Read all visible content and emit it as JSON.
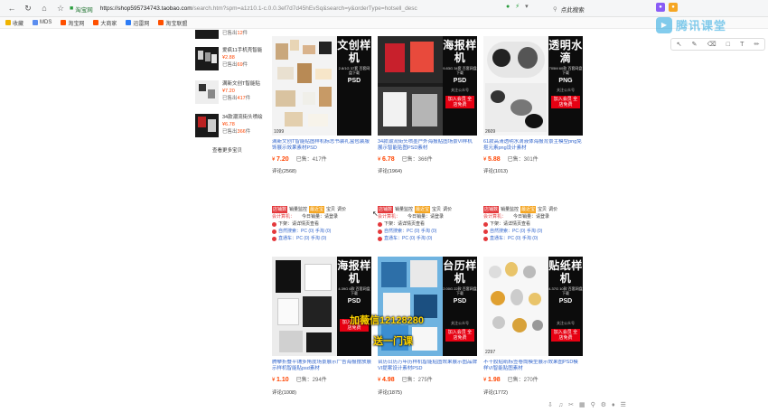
{
  "browser": {
    "site_badge": "淘宝网",
    "url_host": "https://shop595734743.taobao.com",
    "url_path": "/search.htm?spm=a1z10.1-c.0.0.3ef7d7d45hEvSq&search=y&orderType=hotsell_desc",
    "search_placeholder": "点此搜索"
  },
  "bookmarks": [
    {
      "label": "收藏",
      "color": "#f0b400"
    },
    {
      "label": "MDS",
      "color": "#5b8def"
    },
    {
      "label": "淘宝网",
      "color": "#ff5000"
    },
    {
      "label": "大商家",
      "color": "#ff5000"
    },
    {
      "label": "迅雷网",
      "color": "#2e7df6"
    },
    {
      "label": "淘宝联盟",
      "color": "#ff5000"
    }
  ],
  "overlay": {
    "class_logo": "腾讯课堂",
    "watermark_line1": "加薇信12128280",
    "watermark_line2": "送一门课"
  },
  "sidebar": {
    "top_sold_prefix": "已售出",
    "top_sold_count": "12",
    "top_sold_suffix": "件",
    "items": [
      {
        "title": "爱疯11手机壳智能",
        "price": "¥2.88",
        "sold_prefix": "已售出",
        "sold_count": "69",
        "sold_suffix": "件"
      },
      {
        "title": "满新文创T智能贴",
        "price": "¥7.20",
        "sold_prefix": "已售出",
        "sold_count": "417",
        "sold_suffix": "件"
      },
      {
        "title": "34款潮流街头喷绘",
        "price": "¥6.78",
        "sold_prefix": "已售出",
        "sold_count": "366",
        "sold_suffix": "件"
      }
    ],
    "more_link": "查看更多宝贝"
  },
  "products_row1": [
    {
      "big_title": "文创样机",
      "spec": "2.8/1G 37套 百套网盘下载",
      "format": "PSD",
      "img_count": "1099",
      "title": "满新文创T智能贴图样机标志书装礼盒包装服饰展示效果素材PSD",
      "price": "7.20",
      "sold": "已售：417件",
      "review": "评论(2568)"
    },
    {
      "big_title": "海报样机",
      "spec": "9.83G 34套 百套网盘下载",
      "format": "PSD",
      "qr": "关注公众号",
      "vip": "加入会员 全店免费",
      "img_count": "",
      "title": "34款潮流街头喷墨户外海报贴图场景VI样机展示智能贴图PSD素材",
      "price": "6.78",
      "sold": "已售：366件",
      "review": "评论(1964)"
    },
    {
      "big_title": "透明水滴",
      "spec": "705M 60款 百套网盘下载",
      "format": "PNG",
      "qr": "关注公众号",
      "vip": "加入会员 全店免费",
      "img_count": "2609",
      "title": "61款高清透明水滴液体海报背景主模型png免抠元素png设计素材",
      "price": "5.88",
      "sold": "已售：301件",
      "review": "评论(1013)"
    }
  ],
  "products_row2": [
    {
      "tag1": "店铺数",
      "tag2": "销量监控",
      "tag3": "最近宝",
      "tag4": "宝贝",
      "tag5": "调价",
      "line2": "会计算机：",
      "line2b": "今日销量：请登录",
      "line3": "下架：请详情页查看",
      "line4": "自然搜索：PC (0) 手淘 (0)",
      "line5": "直通车：PC (0) 手淘 (0)",
      "big_title": "海报样机",
      "spec": "4.39G 6款 百套网盘下载",
      "format": "PSD",
      "vip": "加入会员 全店免费",
      "title": "腾攀折叠平铺多角度场景展示广告海报摆放展示样机智能贴psd素材",
      "price": "1.10",
      "sold": "已售：294件",
      "review": "评论(1008)"
    },
    {
      "tag1": "店铺数",
      "tag2": "销量监控",
      "tag3": "最近宝",
      "tag4": "宝贝",
      "tag5": "调价",
      "line2": "会计算机：",
      "line2b": "今日销量：请登录",
      "line3": "下架：请详情页查看",
      "line4": "自然搜索：PC (0) 手淘 (0)",
      "line5": "直通车：PC (0) 手淘 (0)",
      "big_title": "台历样机",
      "spec": "2.00G 22款 百套网盘下载",
      "format": "PSD",
      "qr": "关注公众号",
      "vip": "加入会员 全店免费",
      "title": "台历日历万年历样机智能贴图效果展示图品牌VI提案设计素材PSD",
      "price": "4.98",
      "sold": "已售：275件",
      "review": "评论(1875)"
    },
    {
      "tag1": "店铺数",
      "tag2": "销量监控",
      "tag3": "最近宝",
      "tag4": "宝贝",
      "tag5": "调价",
      "line2": "会计算机：",
      "line2b": "今日销量：请登录",
      "line3": "下架：请详情页查看",
      "line4": "自然搜索：PC (0) 手淘 (0)",
      "line5": "直通车：PC (0) 手淘 (0)",
      "big_title": "贴纸样机",
      "spec": "4.37G 10款 百套网盘下载",
      "format": "PSD",
      "qr": "关注公众号",
      "vip": "加入会员 全店免费",
      "img_count": "2297",
      "title": "不干胶贴纸标签卷筒模型展示效果图PSD模样VI智能贴图素材",
      "price": "1.98",
      "sold": "已售：270件",
      "review": "评论(1772)"
    }
  ]
}
